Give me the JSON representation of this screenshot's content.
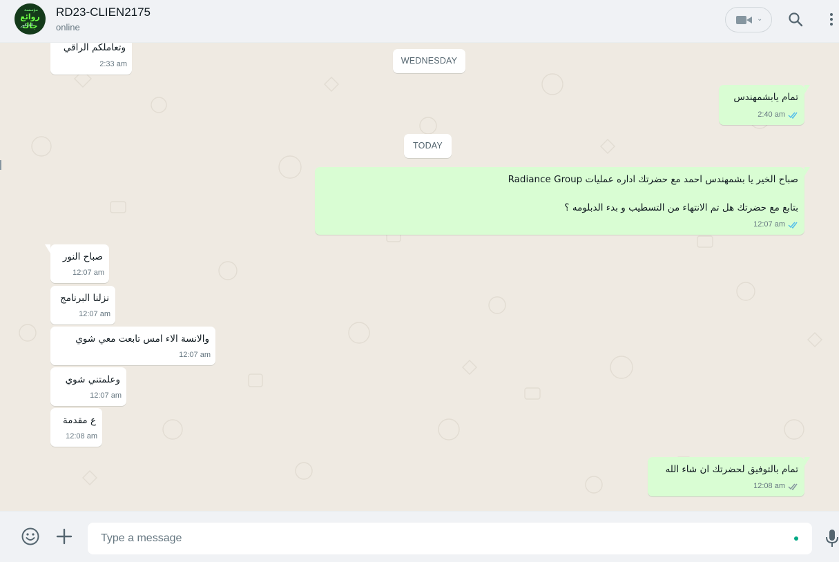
{
  "header": {
    "contact_name": "RD23-CLIEN2175",
    "status": "online",
    "avatar_text": {
      "top": "مؤسسة",
      "main": "روائع جاك",
      "bottom": "للديكور"
    }
  },
  "date_separators": [
    "WEDNESDAY",
    "TODAY"
  ],
  "messages": [
    {
      "direction": "in",
      "text": "وتعاملكم الراقي",
      "time": "2:33 am"
    },
    {
      "direction": "out",
      "text": "تمام يابشمهندس",
      "time": "2:40 am",
      "status": "read"
    },
    {
      "direction": "out",
      "line1": "صباح الخير يا بشمهندس احمد مع  حضرتك اداره عمليات Radiance Group",
      "line2": "بتابع مع حضرتك هل تم الانتهاء من التسطيب و بدء الدبلومه ؟",
      "time": "12:07 am",
      "status": "read"
    },
    {
      "direction": "in",
      "text": "صباح النور",
      "time": "12:07 am"
    },
    {
      "direction": "in",
      "text": "نزلنا البرنامج",
      "time": "12:07 am"
    },
    {
      "direction": "in",
      "text": "والانسة الاء امس تابعت معي شوي",
      "time": "12:07 am"
    },
    {
      "direction": "in",
      "text": "وعلمتني شوي",
      "time": "12:07 am"
    },
    {
      "direction": "in",
      "text": "ع مقدمة",
      "time": "12:08 am"
    },
    {
      "direction": "out",
      "text": "تمام بالتوفيق لحضرتك ان شاء الله",
      "time": "12:08 am",
      "status": "delivered"
    }
  ],
  "composer": {
    "placeholder": "Type a message"
  },
  "icons": [
    "video-call-icon",
    "chevron-down-icon",
    "search-icon",
    "menu-icon",
    "emoji-icon",
    "attach-plus-icon",
    "mic-icon",
    "double-check-icon"
  ],
  "colors": {
    "incoming": "#ffffff",
    "outgoing": "#d9fdd3",
    "read_tick": "#53bdeb",
    "delivered_tick": "#8696a0",
    "accent": "#00a884"
  }
}
